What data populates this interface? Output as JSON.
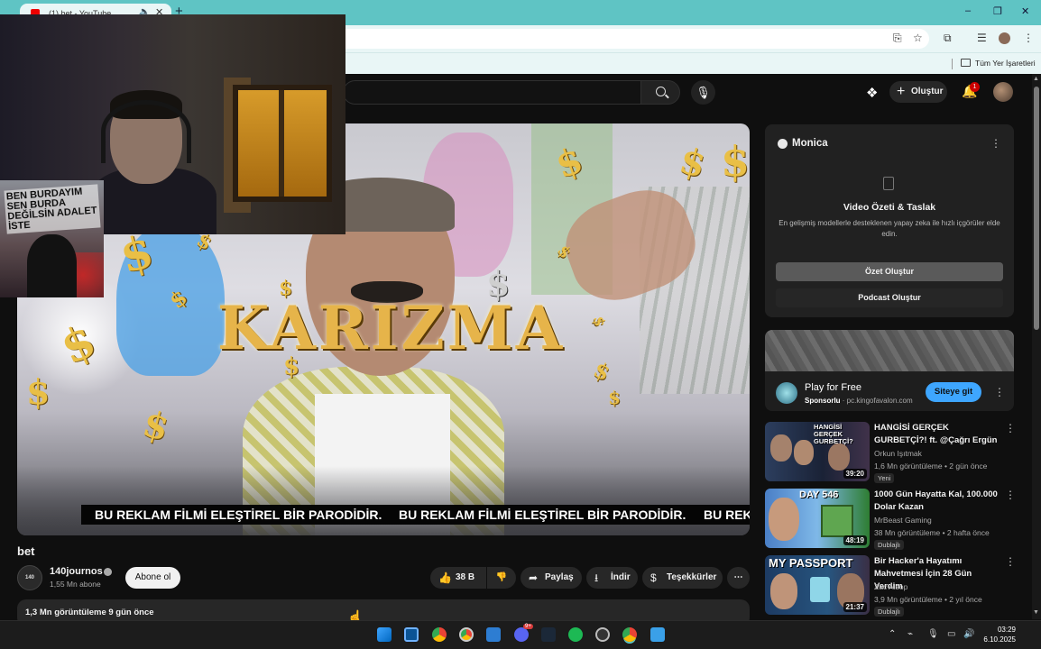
{
  "browser": {
    "tab_title": "(1) bet - YouTube",
    "new_tab": "+",
    "win_min": "–",
    "win_max": "❐",
    "win_close": "✕",
    "bookmarks_label": "Tüm Yer İşaretleri"
  },
  "yt_header": {
    "create_label": "Oluştur",
    "notif_count": "1"
  },
  "video": {
    "overlay_title": "KARIZMA",
    "banner_text": "BU REKLAM FİLMİ ELEŞTİREL BİR PARODİDİR.",
    "banner_cut": "BU REK",
    "poster_text": "BEN BURDAYIM SEN BURDA DEĞİLSİN ADALET İSTE"
  },
  "watch": {
    "title": "bet",
    "channel_avatar_text": "140",
    "channel_name": "140journos",
    "subscribers": "1,55 Mn abone",
    "subscribe_label": "Abone ol",
    "like_count": "38 B",
    "share_label": "Paylaş",
    "download_label": "İndir",
    "thanks_label": "Teşekkürler",
    "more_label": "⋯",
    "description_meta": "1,3 Mn görüntüleme  9 gün önce"
  },
  "monica": {
    "name": "Monica",
    "heading": "Video Özeti & Taslak",
    "body": "En gelişmiş modellerle desteklenen yapay zeka ile hızlı içgörüler elde edin.",
    "button_summary": "Özet Oluştur",
    "button_podcast": "Podcast Oluştur"
  },
  "ad": {
    "title": "Play for Free",
    "sponsored": "Sponsorlu",
    "domain": "· pc.kingofavalon.com",
    "cta": "Siteye git"
  },
  "recommendations": [
    {
      "title": "HANGİSİ GERÇEK GURBETÇİ?! ft. @Çağrı Ergün",
      "channel": "Orkun Işıtmak",
      "meta": "1,6 Mn görüntüleme • 2 gün önce",
      "badge": "Yeni",
      "duration": "39:20",
      "thumb_text": "HANGİSİ GERÇEK GURBETÇİ?"
    },
    {
      "title": "1000 Gün Hayatta Kal, 100.000 Dolar Kazan",
      "channel": "MrBeast Gaming",
      "meta": "38 Mn görüntüleme • 2 hafta önce",
      "badge": "Dublajlı",
      "duration": "48:19",
      "thumb_text": "DAY 546"
    },
    {
      "title": "Bir Hacker'a Hayatımı Mahvetmesi İçin 28 Gün Verdim",
      "channel": "Zac Alsop",
      "meta": "3,9 Mn görüntüleme • 2 yıl önce",
      "badge": "Dublajlı",
      "duration": "21:37",
      "thumb_text": "MY PASSPORT"
    }
  ],
  "taskbar": {
    "time": "03:29",
    "date": "6.10.2025",
    "discord_badge": "9+"
  },
  "colors": {
    "yt_bg": "#0f0f0f",
    "chrome_teal": "#5fc4c4",
    "accent_blue": "#3ea6ff",
    "notif_red": "#cc0000",
    "gold": "#e6b44a"
  }
}
